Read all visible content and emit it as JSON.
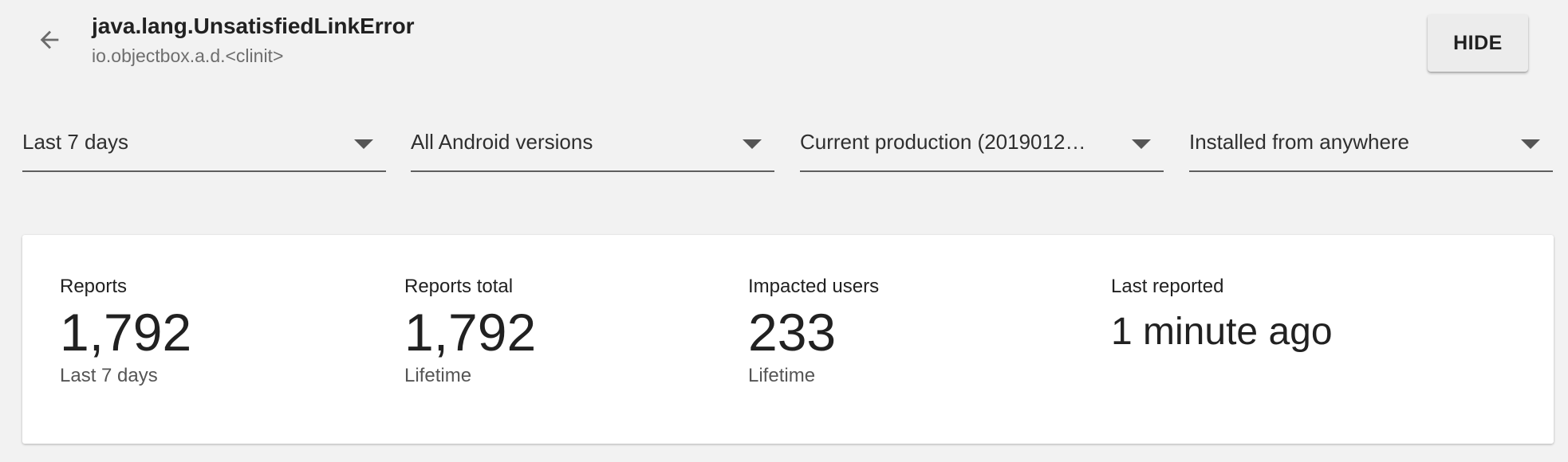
{
  "header": {
    "back_icon": "arrow-left-icon",
    "title": "java.lang.UnsatisfiedLinkError",
    "subtitle": "io.objectbox.a.d.<clinit>",
    "hide_label": "HIDE"
  },
  "filters": [
    {
      "label": "Last 7 days",
      "icon": "caret-down-icon"
    },
    {
      "label": "All Android versions",
      "icon": "caret-down-icon"
    },
    {
      "label": "Current production (2019012…",
      "icon": "caret-down-icon"
    },
    {
      "label": "Installed from anywhere",
      "icon": "caret-down-icon"
    }
  ],
  "stats": [
    {
      "label": "Reports",
      "value": "1,792",
      "sub": "Last 7 days"
    },
    {
      "label": "Reports total",
      "value": "1,792",
      "sub": "Lifetime"
    },
    {
      "label": "Impacted users",
      "value": "233",
      "sub": "Lifetime"
    },
    {
      "label": "Last reported",
      "value": "1 minute ago",
      "sub": ""
    }
  ],
  "colors": {
    "background": "#f2f2f2",
    "card": "#ffffff",
    "text_primary": "#212121",
    "text_secondary": "#6e6e6e"
  }
}
